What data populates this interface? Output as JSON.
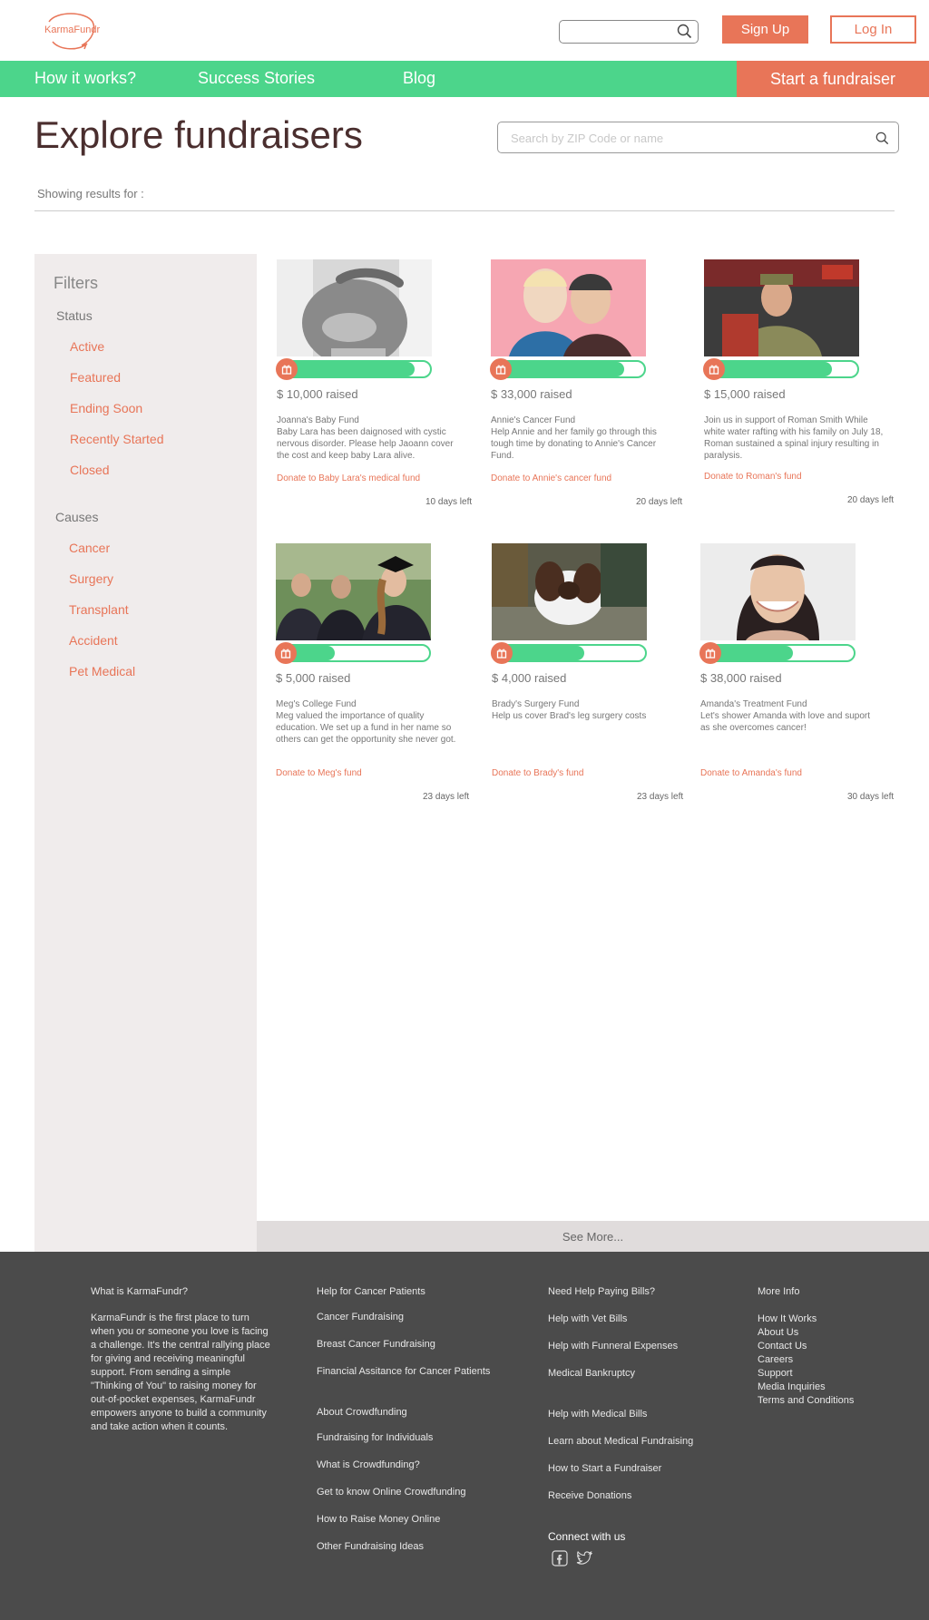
{
  "header": {
    "logo_text": "KarmaFundr",
    "search_value": "",
    "signup_label": "Sign Up",
    "login_label": "Log In"
  },
  "nav": {
    "how": "How it works?",
    "stories": "Success Stories",
    "blog": "Blog",
    "start": "Start a fundraiser"
  },
  "explore": {
    "title": "Explore fundraisers",
    "search_placeholder": "Search by ZIP Code or name",
    "search_value": "",
    "showing": "Showing results for :"
  },
  "filters": {
    "title": "Filters",
    "status_title": "Status",
    "status": [
      "Active",
      "Featured",
      "Ending Soon",
      "Recently Started",
      "Closed"
    ],
    "causes_title": "Causes",
    "causes": [
      "Cancer",
      "Surgery",
      "Transplant",
      "Accident",
      "Pet Medical"
    ]
  },
  "cards": [
    {
      "raised": "$ 10,000 raised",
      "name": "Joanna's Baby Fund",
      "desc": "Baby Lara has been daignosed with cystic nervous disorder. Please help Jaoann cover the cost and keep baby Lara alive.",
      "donate": "Donate to Baby Lara's medical fund",
      "days": "10 days left",
      "progress": 0.9,
      "photo_icon": "pregnancy-ultrasound-photo"
    },
    {
      "raised": "$ 33,000 raised",
      "name": "Annie's Cancer Fund",
      "desc": "Help Annie and her family go through this tough time by donating to Annie's Cancer Fund.",
      "donate": "Donate to  Annie's cancer fund",
      "days": "20  days left",
      "progress": 0.87,
      "photo_icon": "two-women-photo"
    },
    {
      "raised": "$ 15,000 raised",
      "name": "",
      "desc": "Join us in support of Roman Smith While white water rafting with his family on July 18, Roman sustained a spinal injury resulting in paralysis.",
      "donate": "Donate to Roman's fund",
      "days": "20 days left",
      "progress": 0.83,
      "photo_icon": "soldier-photo"
    },
    {
      "raised": "$ 5,000 raised",
      "name": "Meg's College Fund",
      "desc": "Meg valued the importance of quality education. We set up a fund in her name so others can get the opportunity she never got.",
      "donate": "Donate to Meg's fund",
      "days": "23 days left",
      "progress": 0.38,
      "photo_icon": "graduates-photo"
    },
    {
      "raised": "$ 4,000 raised",
      "name": "Brady's Surgery Fund",
      "desc": "Help us cover Brad's leg surgery costs",
      "donate": "Donate to Brady's  fund",
      "days": "23  days left",
      "progress": 0.6,
      "photo_icon": "dog-photo"
    },
    {
      "raised": "$ 38,000 raised",
      "name": "Amanda's Treatment Fund",
      "desc": "Let's shower Amanda with love and suport as she overcomes cancer!",
      "donate": "Donate to Amanda's fund",
      "days": "30  days left",
      "progress": 0.6,
      "photo_icon": "woman-portrait-photo"
    }
  ],
  "see_more": "See More...",
  "footer": {
    "what_title": "What is KarmaFundr?",
    "about": "KarmaFundr is the first place to turn when you or someone you love is facing a challenge. It's the central  rallying place for giving and receiving meaningful support. From sending a simple \"Thinking of You\" to raising money for out-of-pocket expenses, KarmaFundr empowers anyone to  build a community and take action when it counts.",
    "col2a": [
      "Help for Cancer Patients",
      "Cancer Fundraising",
      "Breast Cancer Fundraising",
      "Financial Assitance for Cancer Patients"
    ],
    "col2b": [
      "About Crowdfunding",
      "Fundraising for Individuals",
      "What is Crowdfunding?",
      "Get to know Online Crowdfunding",
      "How to Raise Money Online",
      "Other Fundraising Ideas"
    ],
    "col3a": [
      "Need Help Paying Bills?",
      "Help with Vet Bills",
      "Help with Funneral Expenses",
      "Medical Bankruptcy"
    ],
    "col3b": [
      "Help with Medical Bills",
      "Learn about Medical Fundraising",
      "How to Start a Fundraiser",
      "Receive Donations"
    ],
    "connect": "Connect with us",
    "more_title": "More Info",
    "more": [
      "How It Works",
      "About Us",
      "Contact Us",
      "Careers",
      "Support",
      "Media Inquiries",
      "Terms and Conditions"
    ]
  },
  "colors": {
    "accent_orange": "#e87558",
    "accent_green": "#4cd58b",
    "footer_bg": "#4b4b4b"
  }
}
